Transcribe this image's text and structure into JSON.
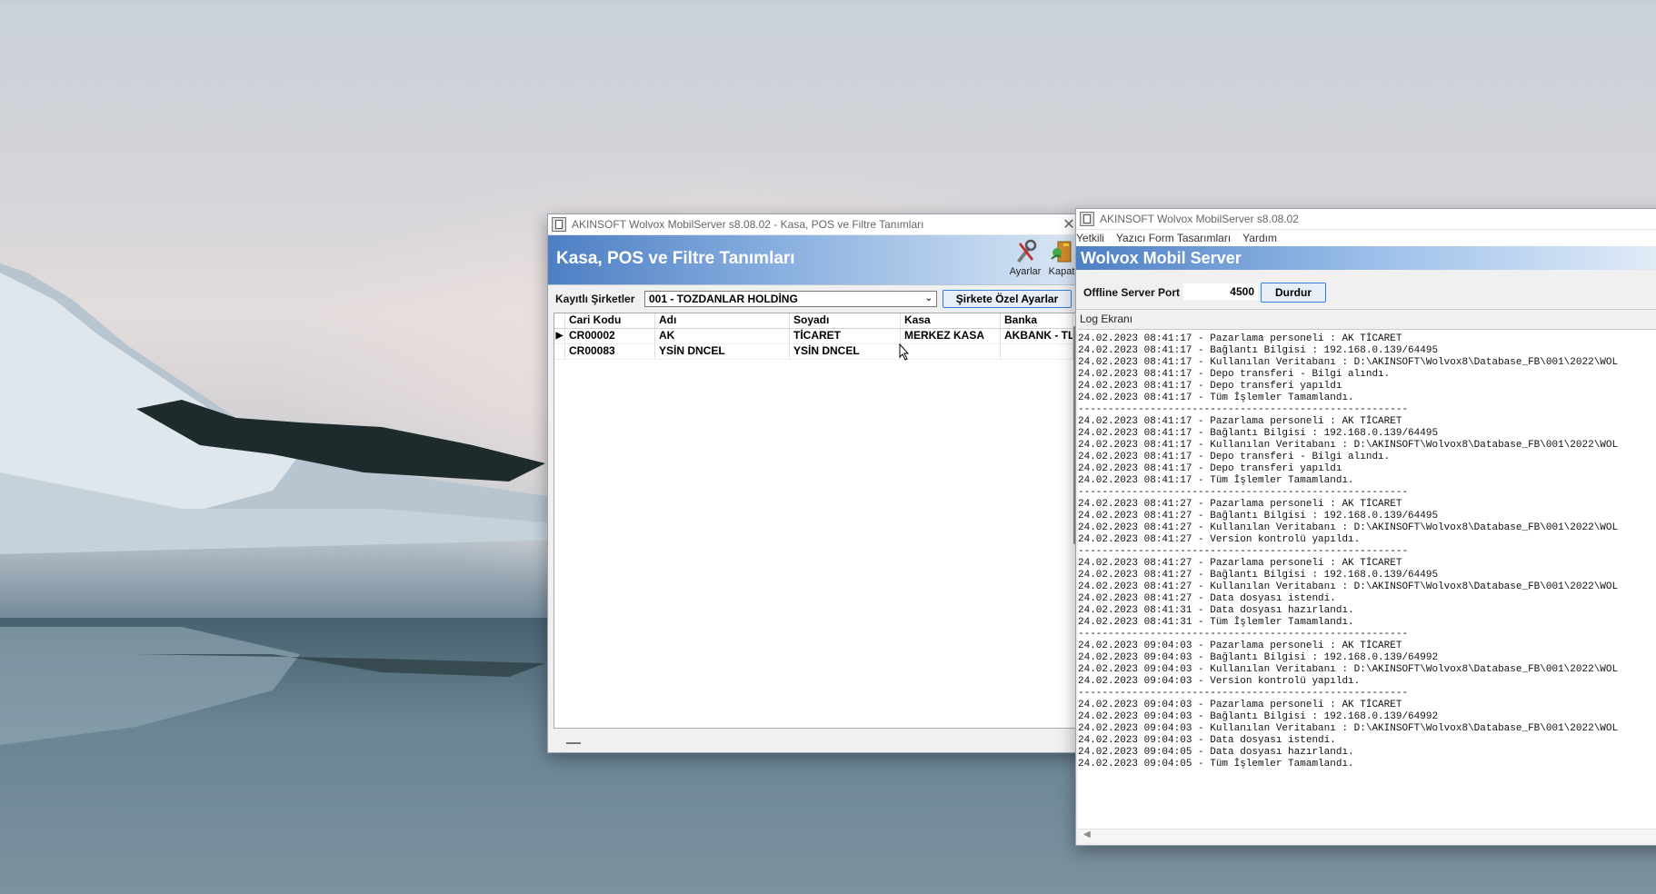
{
  "kasa_window": {
    "title": "AKINSOFT Wolvox MobilServer s8.08.02 - Kasa,  POS ve Filtre Tanımları",
    "banner_title": "Kasa,  POS ve Filtre Tanımları",
    "settings_label": "Ayarlar",
    "close_label": "Kapat",
    "company_label": "Kayıtlı Şirketler",
    "company_value": "001 - TOZDANLAR HOLDİNG",
    "company_settings_button": "Şirkete Özel Ayarlar",
    "columns": [
      "Cari Kodu",
      "Adı",
      "Soyadı",
      "Kasa",
      "Banka"
    ],
    "rows": [
      {
        "indicator": "▶",
        "code": "CR00002",
        "name": "AK",
        "surname": "TİCARET",
        "kasa": "MERKEZ KASA",
        "banka": "AKBANK - TL"
      },
      {
        "indicator": "",
        "code": "CR00083",
        "name": "YSİN DNCEL",
        "surname": "YSİN DNCEL",
        "kasa": "",
        "banka": ""
      }
    ]
  },
  "server_window": {
    "title": "AKINSOFT Wolvox MobilServer s8.08.02",
    "menu": [
      "Yetkili",
      "Yazıcı Form Tasarımları",
      "Yardım"
    ],
    "banner_title": "Wolvox Mobil Server",
    "port_label": "Offline Server Port",
    "port_value": "4500",
    "stop_button": "Durdur",
    "log_tab": "Log Ekranı",
    "log_lines": [
      "24.02.2023 08:41:17 - Pazarlama personeli : AK TİCARET",
      "24.02.2023 08:41:17 - Bağlantı Bilgisi : 192.168.0.139/64495",
      "24.02.2023 08:41:17 - Kullanılan Veritabanı : D:\\AKINSOFT\\Wolvox8\\Database_FB\\001\\2022\\WOL",
      "24.02.2023 08:41:17 - Depo transferi - Bilgi alındı.",
      "24.02.2023 08:41:17 - Depo transferi yapıldı",
      "24.02.2023 08:41:17 - Tüm İşlemler Tamamlandı.",
      "-------------------------------------------------------",
      "24.02.2023 08:41:17 - Pazarlama personeli : AK TİCARET",
      "24.02.2023 08:41:17 - Bağlantı Bilgisi : 192.168.0.139/64495",
      "24.02.2023 08:41:17 - Kullanılan Veritabanı : D:\\AKINSOFT\\Wolvox8\\Database_FB\\001\\2022\\WOL",
      "24.02.2023 08:41:17 - Depo transferi - Bilgi alındı.",
      "24.02.2023 08:41:17 - Depo transferi yapıldı",
      "24.02.2023 08:41:17 - Tüm İşlemler Tamamlandı.",
      "-------------------------------------------------------",
      "24.02.2023 08:41:27 - Pazarlama personeli : AK TİCARET",
      "24.02.2023 08:41:27 - Bağlantı Bilgisi : 192.168.0.139/64495",
      "24.02.2023 08:41:27 - Kullanılan Veritabanı : D:\\AKINSOFT\\Wolvox8\\Database_FB\\001\\2022\\WOL",
      "24.02.2023 08:41:27 - Version kontrolü yapıldı.",
      "-------------------------------------------------------",
      "24.02.2023 08:41:27 - Pazarlama personeli : AK TİCARET",
      "24.02.2023 08:41:27 - Bağlantı Bilgisi : 192.168.0.139/64495",
      "24.02.2023 08:41:27 - Kullanılan Veritabanı : D:\\AKINSOFT\\Wolvox8\\Database_FB\\001\\2022\\WOL",
      "24.02.2023 08:41:27 - Data dosyası istendi.",
      "24.02.2023 08:41:31 - Data dosyası hazırlandı.",
      "24.02.2023 08:41:31 - Tüm İşlemler Tamamlandı.",
      "-------------------------------------------------------",
      "24.02.2023 09:04:03 - Pazarlama personeli : AK TİCARET",
      "24.02.2023 09:04:03 - Bağlantı Bilgisi : 192.168.0.139/64992",
      "24.02.2023 09:04:03 - Kullanılan Veritabanı : D:\\AKINSOFT\\Wolvox8\\Database_FB\\001\\2022\\WOL",
      "24.02.2023 09:04:03 - Version kontrolü yapıldı.",
      "-------------------------------------------------------",
      "24.02.2023 09:04:03 - Pazarlama personeli : AK TİCARET",
      "24.02.2023 09:04:03 - Bağlantı Bilgisi : 192.168.0.139/64992",
      "24.02.2023 09:04:03 - Kullanılan Veritabanı : D:\\AKINSOFT\\Wolvox8\\Database_FB\\001\\2022\\WOL",
      "24.02.2023 09:04:03 - Data dosyası istendi.",
      "24.02.2023 09:04:05 - Data dosyası hazırlandı.",
      "24.02.2023 09:04:05 - Tüm İşlemler Tamamlandı."
    ]
  },
  "icons": [
    "app-icon",
    "close-icon",
    "settings-tools-icon",
    "exit-door-icon",
    "dropdown-chevron-icon",
    "row-indicator-icon",
    "mouse-cursor-icon"
  ],
  "colors": {
    "banner_blue": "#4d7fc4",
    "button_border": "#2f7fd8"
  }
}
